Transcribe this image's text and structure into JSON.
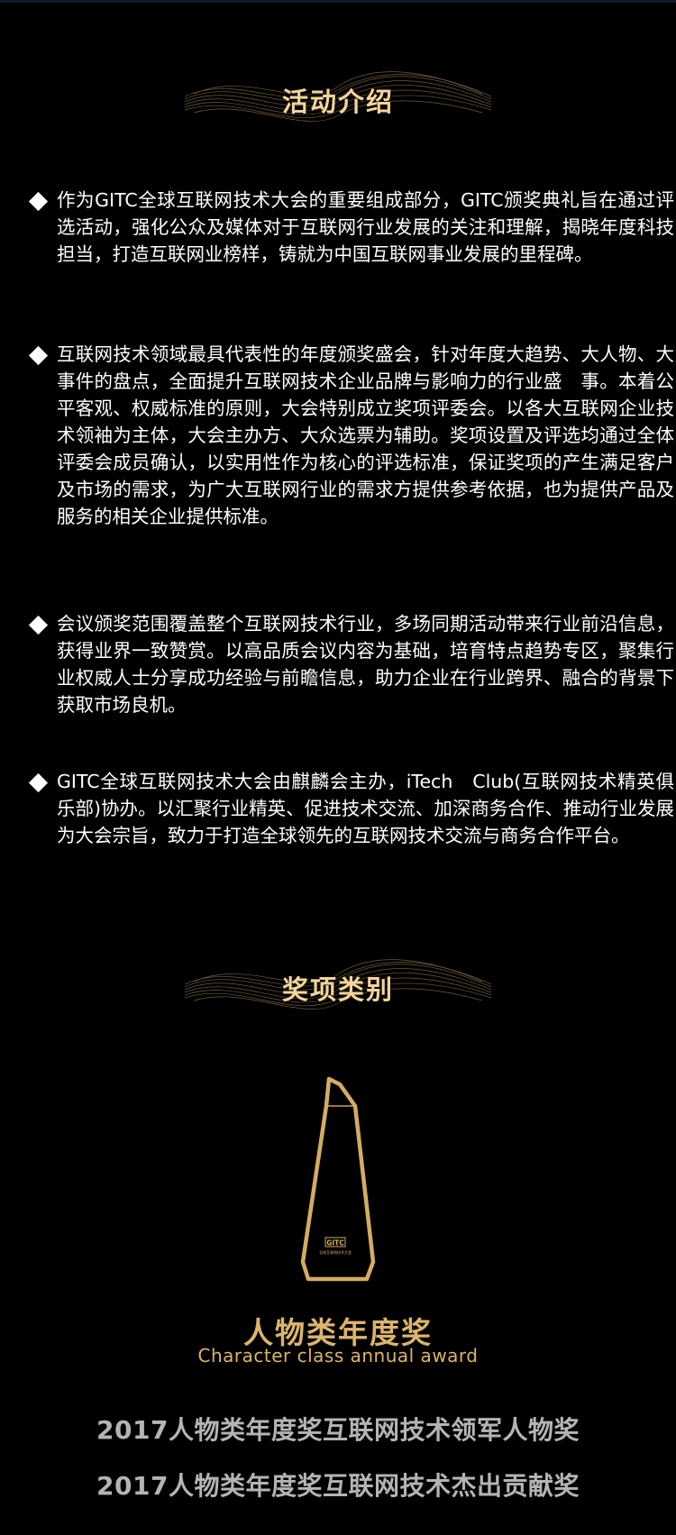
{
  "sections": {
    "intro_title": "活动介绍",
    "awards_title": "奖项类别"
  },
  "intro": [
    "作为GITC全球互联网技术大会的重要组成部分，GITC颁奖典礼旨在通过评选活动，强化公众及媒体对于互联网行业发展的关注和理解，揭晓年度科技担当，打造互联网业榜样，铸就为中国互联网事业发展的里程碑。",
    "互联网技术领域最具代表性的年度颁奖盛会，针对年度大趋势、大人物、大事件的盘点，全面提升互联网技术企业品牌与影响力的行业盛　事。本着公平客观、权威标准的原则，大会特别成立奖项评委会。以各大互联网企业技术领袖为主体，大会主办方、大众选票为辅助。奖项设置及评选均通过全体评委会成员确认，以实用性作为核心的评选标准，保证奖项的产生满足客户及市场的需求，为广大互联网行业的需求方提供参考依据，也为提供产品及服务的相关企业提供标准。",
    "会议颁奖范围覆盖整个互联网技术行业，多场同期活动带来行业前沿信息，获得业界一致赞赏。以高品质会议内容为基础，培育特点趋势专区，聚集行业权威人士分享成功经验与前瞻信息，助力企业在行业跨界、融合的背景下获取市场良机。",
    "GITC全球互联网技术大会由麒麟会主办，iTech　Club(互联网技术精英俱乐部)协办。以汇聚行业精英、促进技术交流、加深商务合作、推动行业发展为大会宗旨，致力于打造全球领先的互联网技术交流与商务合作平台。"
  ],
  "award": {
    "name_cn": "人物类年度奖",
    "name_en": "Character class annual award",
    "trophy_logo": "GITC",
    "trophy_caption": "全球互联网技术大会",
    "items": [
      "2017人物类年度奖互联网技术领军人物奖",
      "2017人物类年度奖互联网技术杰出贡献奖"
    ]
  },
  "colors": {
    "background": "#000000",
    "gold": "#dcb46b",
    "title_gold": "#f3d49a",
    "body_text": "#ffffff",
    "list_gray": "#b4b4b4"
  }
}
